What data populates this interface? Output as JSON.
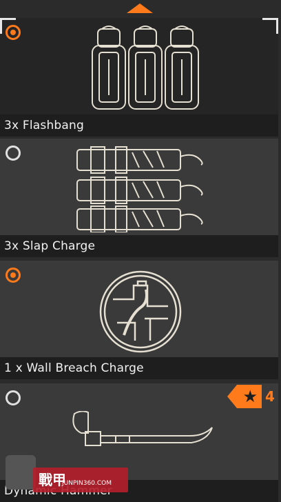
{
  "scroll": {
    "up_icon": "chevron-up-icon"
  },
  "items": [
    {
      "label": "3x Flashbang",
      "selected": true,
      "radio_selected": true
    },
    {
      "label": "3x Slap Charge",
      "selected": false,
      "radio_selected": false
    },
    {
      "label": "1 x Wall Breach Charge",
      "selected": false,
      "radio_selected": true
    },
    {
      "label": "Dynamic Hammer",
      "selected": false,
      "radio_selected": false,
      "badge": {
        "icon": "star-icon",
        "count": "4"
      }
    }
  ],
  "watermark": {
    "text": "戰甲",
    "url": "JUNPIN360.COM"
  },
  "colors": {
    "accent": "#ff7a1a",
    "card": "#3a3a3a",
    "label_bar": "#1e1e1e"
  }
}
